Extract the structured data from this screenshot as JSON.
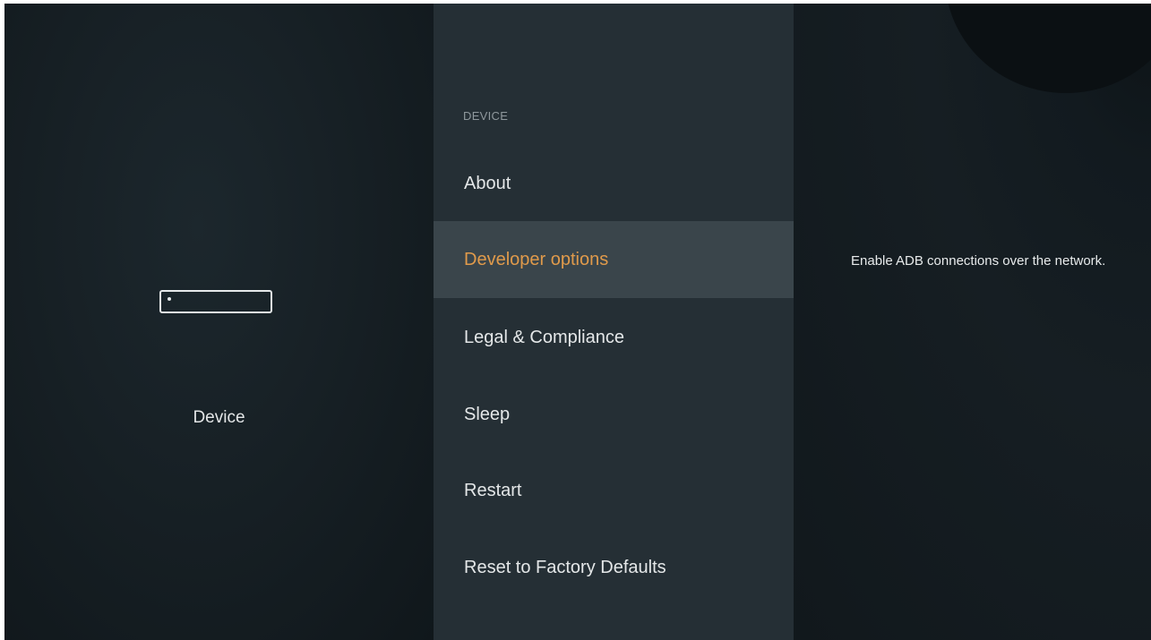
{
  "left_panel": {
    "icon": "fire-tv-device-icon",
    "label": "Device"
  },
  "menu": {
    "section_header": "DEVICE",
    "items": [
      {
        "label": "About",
        "selected": false
      },
      {
        "label": "Developer options",
        "selected": true
      },
      {
        "label": "Legal & Compliance",
        "selected": false
      },
      {
        "label": "Sleep",
        "selected": false
      },
      {
        "label": "Restart",
        "selected": false
      },
      {
        "label": "Reset to Factory Defaults",
        "selected": false
      }
    ]
  },
  "description": {
    "text": "Enable ADB connections over the network."
  },
  "colors": {
    "background": "#141c21",
    "menu_background": "#252f35",
    "selected_background": "#3a454b",
    "accent": "#e09a4b",
    "text": "#e4e7e8",
    "header_text": "#8f989d"
  }
}
